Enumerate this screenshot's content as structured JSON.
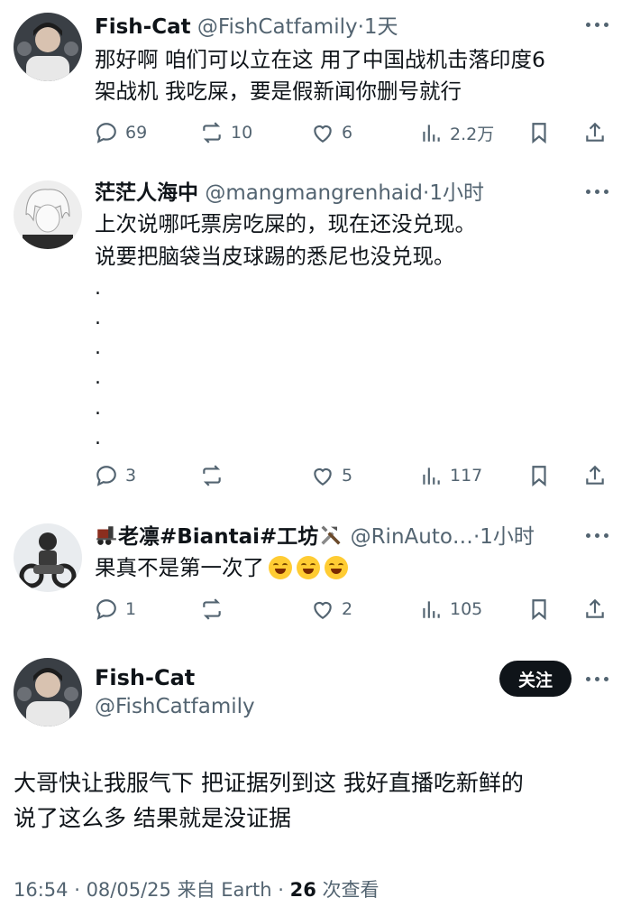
{
  "reply1": {
    "name": "Fish-Cat",
    "handle": "@FishCatfamily",
    "time": "1天",
    "lines": [
      "那好啊 咱们可以立在这 用了中国战机击落印度6",
      "架战机 我吃屎，要是假新闻你删号就行"
    ],
    "replies": "69",
    "reposts": "10",
    "likes": "6",
    "views": "2.2万"
  },
  "reply2": {
    "name": "茫茫人海中",
    "handle": "@mangmangrenhaid",
    "time": "1小时",
    "lines": [
      "上次说哪吒票房吃屎的，现在还没兑现。",
      "说要把脑袋当皮球踢的悉尼也没兑现。"
    ],
    "dots": [
      ".",
      ".",
      ".",
      ".",
      ".",
      "."
    ],
    "replies": "3",
    "reposts": "",
    "likes": "5",
    "views": "117"
  },
  "reply3": {
    "name": "老凛#Biantai#工坊",
    "handle": "@RinAuto…",
    "time": "1小时",
    "text": "果真不是第一次了",
    "replies": "1",
    "reposts": "",
    "likes": "2",
    "views": "105"
  },
  "main_post": {
    "name": "Fish-Cat",
    "handle": "@FishCatfamily",
    "follow_label": "关注",
    "lines": [
      "大哥快让我服气下 把证据列到这 我好直播吃新鲜的",
      "说了这么多 结果就是没证据"
    ],
    "time": "16:54",
    "date": "08/05/25",
    "source": "来自 Earth",
    "views_count": "26",
    "views_label": "次查看"
  },
  "icons": [
    "reply-icon",
    "repost-icon",
    "like-icon",
    "views-icon",
    "bookmark-icon",
    "share-icon",
    "more-icon",
    "train-icon",
    "tools-icon",
    "laughing-emoji"
  ]
}
